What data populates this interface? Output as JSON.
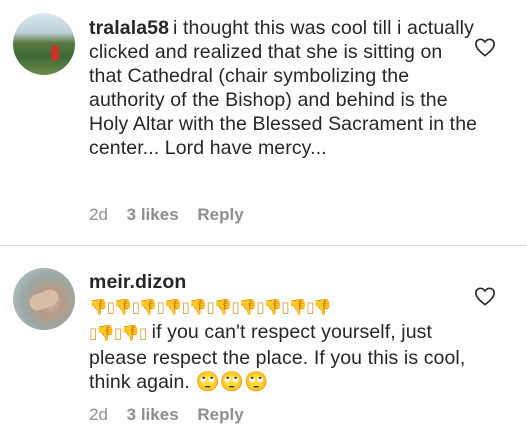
{
  "comments": [
    {
      "username": "tralala58",
      "text": "i thought this was cool till i actually clicked and realized that she is sitting on that Cathedral (chair symbolizing the authority of the Bishop) and behind is the Holy Altar with the Blessed Sacrament in the center... Lord have mercy...",
      "time": "2d",
      "likes": "3 likes",
      "reply": "Reply"
    },
    {
      "username": "meir.dizon",
      "emoji_line_1": "👎▯👎▯👎▯👎▯👎▯👎▯👎▯👎▯👎▯👎",
      "emoji_line_2_prefix": "▯👎▯👎▯",
      "text": "if you can't respect yourself, just please respect the place. If you this is cool, think again.",
      "trailing_emoji": "🙄🙄🙄",
      "time": "2d",
      "likes": "3 likes",
      "reply": "Reply"
    }
  ],
  "icons": {
    "like": "heart-outline-icon"
  },
  "colors": {
    "text": "#262626",
    "meta": "#8e8e8e",
    "divider": "#dbdbdb"
  }
}
